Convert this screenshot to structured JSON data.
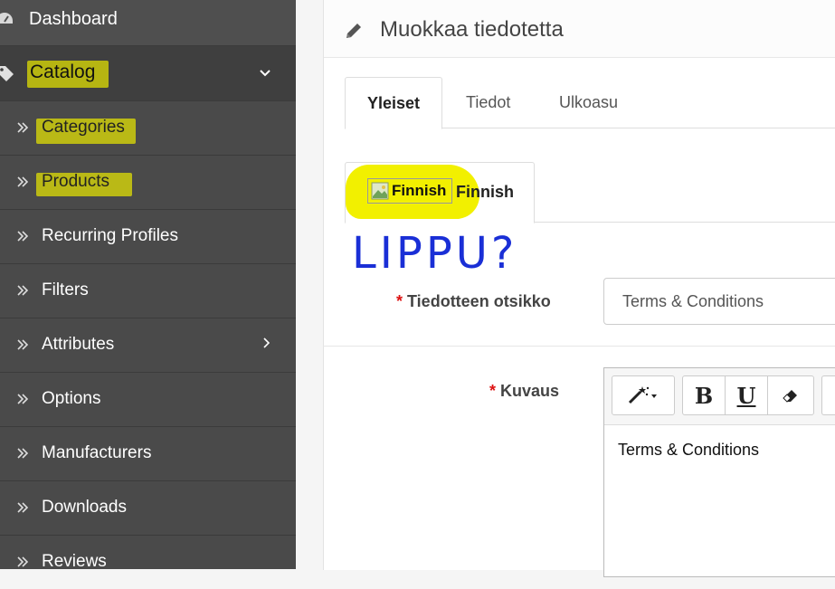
{
  "sidebar": {
    "dashboard": "Dashboard",
    "catalog": "Catalog",
    "items": [
      {
        "label": "Categories"
      },
      {
        "label": "Products"
      },
      {
        "label": "Recurring Profiles"
      },
      {
        "label": "Filters"
      },
      {
        "label": "Attributes"
      },
      {
        "label": "Options"
      },
      {
        "label": "Manufacturers"
      },
      {
        "label": "Downloads"
      },
      {
        "label": "Reviews"
      }
    ]
  },
  "panel": {
    "title": "Muokkaa tiedotetta",
    "tabs": [
      "Yleiset",
      "Tiedot",
      "Ulkoasu"
    ],
    "language_tab": {
      "flag_alt": "Finnish",
      "label": "Finnish"
    },
    "annotation": "LIPPU?",
    "fields": {
      "title_label": "Tiedotteen otsikko",
      "title_value": "Terms & Conditions",
      "desc_label": "Kuvaus",
      "editor_text": "Terms & Conditions"
    },
    "required_mark": "*"
  },
  "colors": {
    "highlight": "#f2f000",
    "sidebar_bg": "#4a4a4a",
    "required": "#dd1111",
    "scribble": "#1a2fd6"
  }
}
